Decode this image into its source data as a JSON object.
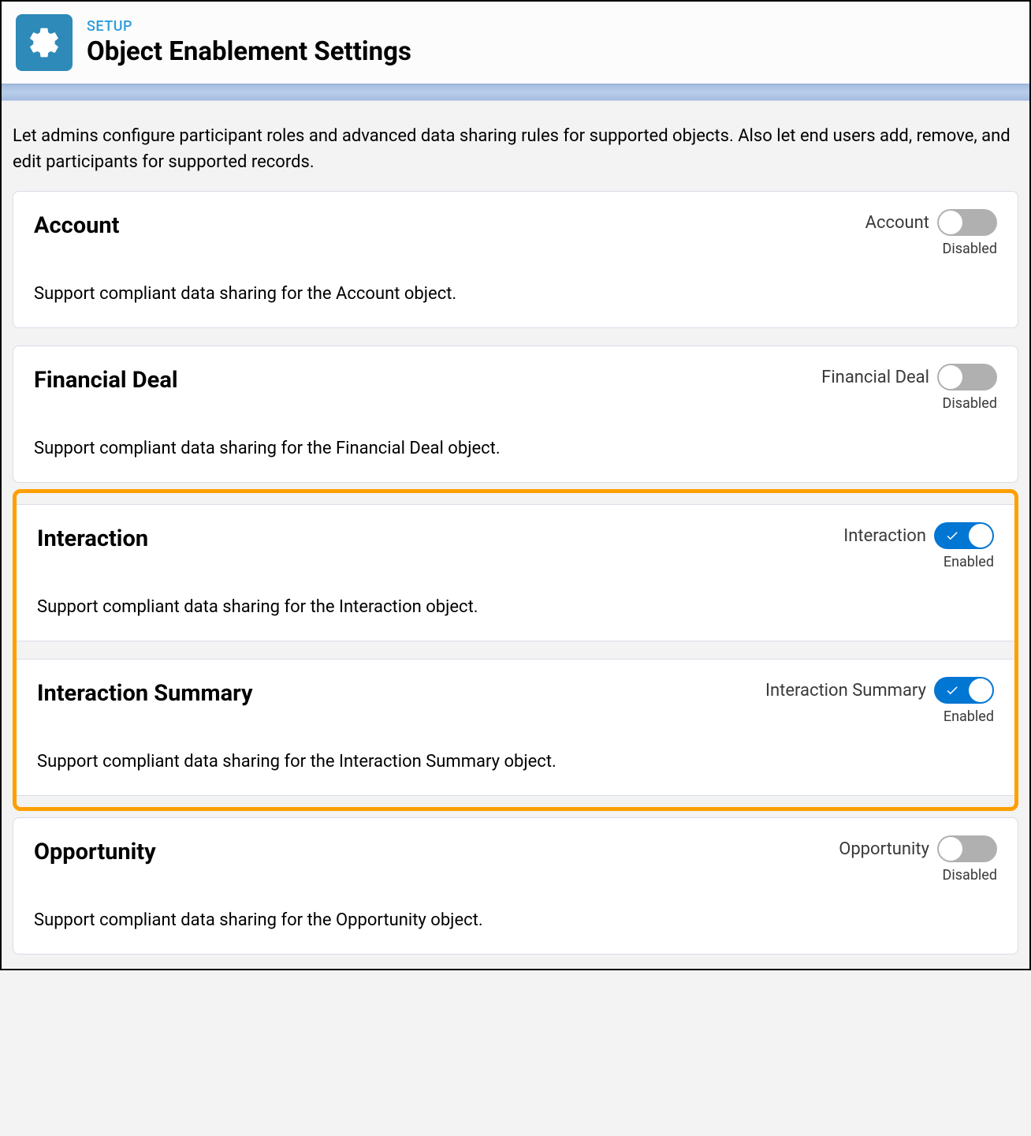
{
  "header": {
    "breadcrumb": "SETUP",
    "title": "Object Enablement Settings"
  },
  "description": "Let admins configure participant roles and advanced data sharing rules for supported objects. Also let end users add, remove, and edit participants for supported records.",
  "status_labels": {
    "enabled": "Enabled",
    "disabled": "Disabled"
  },
  "cards": [
    {
      "title": "Account",
      "description": "Support compliant data sharing for the Account object.",
      "toggle_label": "Account",
      "enabled": false,
      "highlighted": false
    },
    {
      "title": "Financial Deal",
      "description": "Support compliant data sharing for the Financial Deal object.",
      "toggle_label": "Financial Deal",
      "enabled": false,
      "highlighted": false
    },
    {
      "title": "Interaction",
      "description": "Support compliant data sharing for the Interaction object.",
      "toggle_label": "Interaction",
      "enabled": true,
      "highlighted": true
    },
    {
      "title": "Interaction Summary",
      "description": "Support compliant data sharing for the Interaction Summary object.",
      "toggle_label": "Interaction Summary",
      "enabled": true,
      "highlighted": true
    },
    {
      "title": "Opportunity",
      "description": "Support compliant data sharing for the Opportunity object.",
      "toggle_label": "Opportunity",
      "enabled": false,
      "highlighted": false
    }
  ]
}
